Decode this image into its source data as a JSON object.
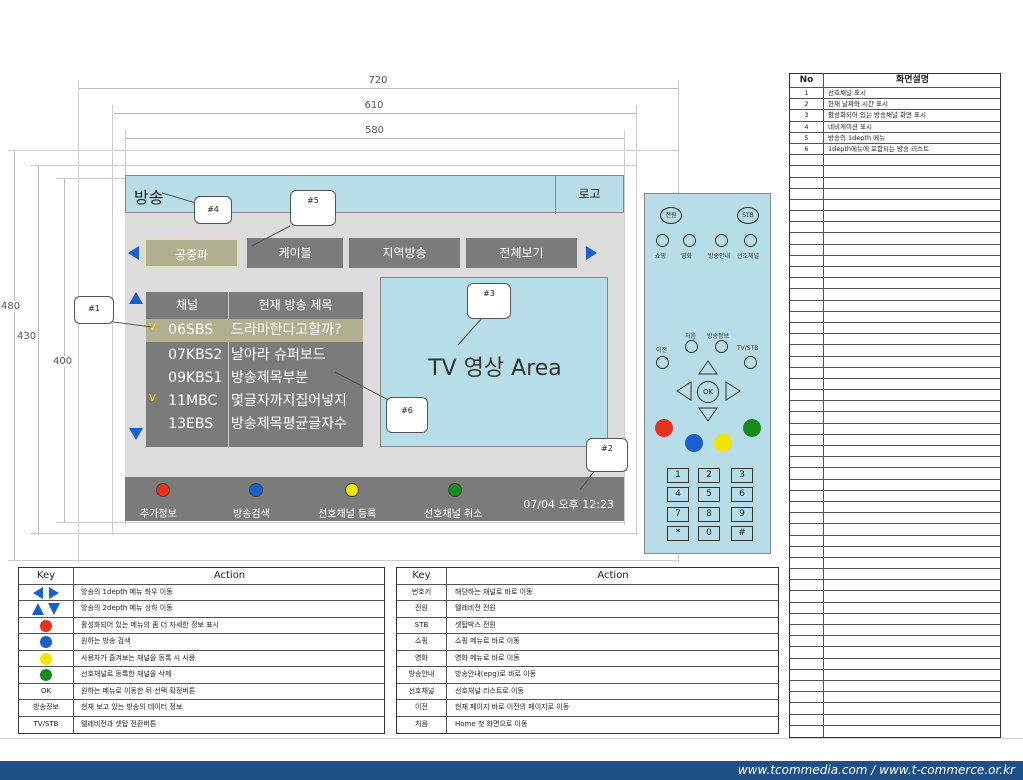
{
  "dimensions": {
    "w720": "720",
    "w610": "610",
    "w580": "580",
    "h480": "480",
    "h430": "430",
    "h400": "400"
  },
  "screen": {
    "header_title": "방송",
    "logo": "로고",
    "tabs": [
      "공중파",
      "케이블",
      "지역방송",
      "전체보기"
    ],
    "list_headers": {
      "channel": "채널",
      "title": "현재 방송 제목"
    },
    "rows": [
      {
        "check": "V",
        "num": "06",
        "ch": "SBS",
        "title": "드라마한다고할까?",
        "selected": true
      },
      {
        "check": "",
        "num": "07",
        "ch": "KBS2",
        "title": "날아라 슈퍼보드",
        "selected": false
      },
      {
        "check": "",
        "num": "09",
        "ch": "KBS1",
        "title": "방송제목부분",
        "selected": false
      },
      {
        "check": "V",
        "num": "11",
        "ch": "MBC",
        "title": "몇글자까지집어넣지",
        "selected": false
      },
      {
        "check": "",
        "num": "13",
        "ch": "EBS",
        "title": "방송제목평균글자수",
        "selected": false
      }
    ],
    "video_text": "TV 영상 Area",
    "bottom_buttons": [
      {
        "label": "추가정보",
        "color": "#e8301a"
      },
      {
        "label": "방송검색",
        "color": "#1a5fd0"
      },
      {
        "label": "선호채널 등록",
        "color": "#f2e500"
      },
      {
        "label": "선호채널 취소",
        "color": "#1a8a1a"
      }
    ],
    "clock": "07/04 오후 12:23"
  },
  "callouts": {
    "c1": "#1",
    "c2": "#2",
    "c3": "#3",
    "c4": "#4",
    "c5": "#5",
    "c6": "#6"
  },
  "remote": {
    "power": "전원",
    "stb": "STB",
    "quick": [
      "쇼핑",
      "영화",
      "방송안내",
      "선호채널"
    ],
    "first": "처음",
    "info": "방송정보",
    "prev": "이전",
    "tvstb": "TV/STB",
    "ok": "OK",
    "numbers": [
      "1",
      "2",
      "3",
      "4",
      "5",
      "6",
      "7",
      "8",
      "9",
      "*",
      "0",
      "#"
    ]
  },
  "desc_table": {
    "head_no": "No",
    "head_desc": "화면설명",
    "rows": [
      {
        "no": "1",
        "desc": "선호채널 표시"
      },
      {
        "no": "2",
        "desc": "현재 날짜와 시간 표시"
      },
      {
        "no": "3",
        "desc": "활성화되어 있는 방송채널 화면 표시"
      },
      {
        "no": "4",
        "desc": "네비게이션 표시"
      },
      {
        "no": "5",
        "desc": "방송의 1depth 메뉴"
      },
      {
        "no": "6",
        "desc": "1depth메뉴에 포함되는 방송 리스트"
      }
    ]
  },
  "key_table_left": {
    "head_key": "Key",
    "head_action": "Action",
    "rows": [
      {
        "key": "lr-arrows",
        "action": "방송의 1depth 메뉴 좌우 이동"
      },
      {
        "key": "ud-arrows",
        "action": "방송의 2depth 메뉴 상하 이동"
      },
      {
        "key": "red",
        "action": "활성화되어 있는 메뉴의 좀 더 자세한 정보 표시"
      },
      {
        "key": "blue",
        "action": "원하는 방송 검색"
      },
      {
        "key": "yellow",
        "action": "사용자가 즐겨보는 채널을 등록 시 사용"
      },
      {
        "key": "green",
        "action": "선호채널로 등록한 채널을 삭제"
      },
      {
        "key": "OK",
        "action": "원하는 메뉴로 이동한 뒤 선택 확정버튼"
      },
      {
        "key": "방송정보",
        "action": "현재 보고 있는 방송의 데이터 정보"
      },
      {
        "key": "TV/STB",
        "action": "텔레비전과 셋탑 전환버튼"
      }
    ]
  },
  "key_table_right": {
    "head_key": "Key",
    "head_action": "Action",
    "rows": [
      {
        "key": "번호키",
        "action": "해당하는 채널로 바로 이동"
      },
      {
        "key": "전원",
        "action": "텔레비전 전원"
      },
      {
        "key": "STB",
        "action": "셋탑박스 전원"
      },
      {
        "key": "쇼핑",
        "action": "쇼핑 메뉴로 바로 이동"
      },
      {
        "key": "영화",
        "action": "영화 메뉴로 바로 이동"
      },
      {
        "key": "방송안내",
        "action": "방송안내(epg)로 바로 이동"
      },
      {
        "key": "선호채널",
        "action": "선호채널 리스트로 이동"
      },
      {
        "key": "이전",
        "action": "현재 페이지 바로 이전의 페이지로 이동"
      },
      {
        "key": "처음",
        "action": "Home 첫 화면으로 이동"
      }
    ]
  },
  "footer": "www.tcommedia.com / www.t-commerce.or.kr"
}
